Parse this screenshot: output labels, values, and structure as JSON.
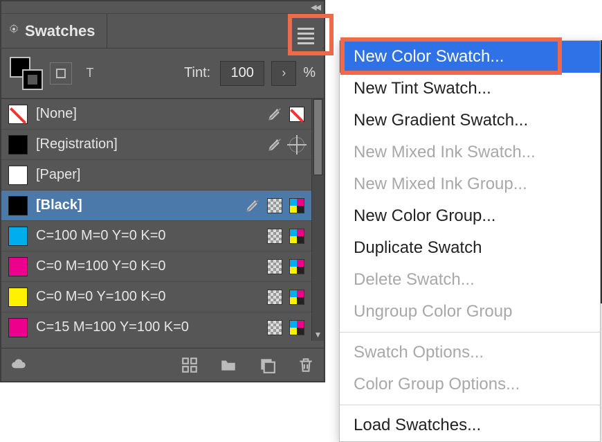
{
  "panel": {
    "title": "Swatches",
    "tint_label": "Tint:",
    "tint_value": "100",
    "tint_unit": "%"
  },
  "swatches": [
    {
      "label": "[None]",
      "chip": "none",
      "locked": true,
      "mode": "none"
    },
    {
      "label": "[Registration]",
      "chip": "black",
      "locked": true,
      "mode": "reg"
    },
    {
      "label": "[Paper]",
      "chip": "white",
      "locked": false,
      "mode": "plain"
    },
    {
      "label": "[Black]",
      "chip": "black",
      "locked": true,
      "mode": "cmyk",
      "selected": true
    },
    {
      "label": "C=100 M=0 Y=0 K=0",
      "chip": "cyan",
      "locked": false,
      "mode": "cmyk"
    },
    {
      "label": "C=0 M=100 Y=0 K=0",
      "chip": "magenta",
      "locked": false,
      "mode": "cmyk"
    },
    {
      "label": "C=0 M=0 Y=100 K=0",
      "chip": "yellow",
      "locked": false,
      "mode": "cmyk"
    },
    {
      "label": "C=15 M=100 Y=100 K=0",
      "chip": "magenta",
      "locked": false,
      "mode": "cmyk"
    }
  ],
  "menu": {
    "items": [
      {
        "label": "New Color Swatch...",
        "enabled": true,
        "highlight": true
      },
      {
        "label": "New Tint Swatch...",
        "enabled": true
      },
      {
        "label": "New Gradient Swatch...",
        "enabled": true
      },
      {
        "label": "New Mixed Ink Swatch...",
        "enabled": false
      },
      {
        "label": "New Mixed Ink Group...",
        "enabled": false
      },
      {
        "label": "New Color Group...",
        "enabled": true
      },
      {
        "label": "Duplicate Swatch",
        "enabled": true
      },
      {
        "label": "Delete Swatch...",
        "enabled": false
      },
      {
        "label": "Ungroup Color Group",
        "enabled": false
      },
      {
        "sep": true
      },
      {
        "label": "Swatch Options...",
        "enabled": false
      },
      {
        "label": "Color Group Options...",
        "enabled": false
      },
      {
        "sep": true
      },
      {
        "label": "Load Swatches...",
        "enabled": true
      }
    ]
  }
}
